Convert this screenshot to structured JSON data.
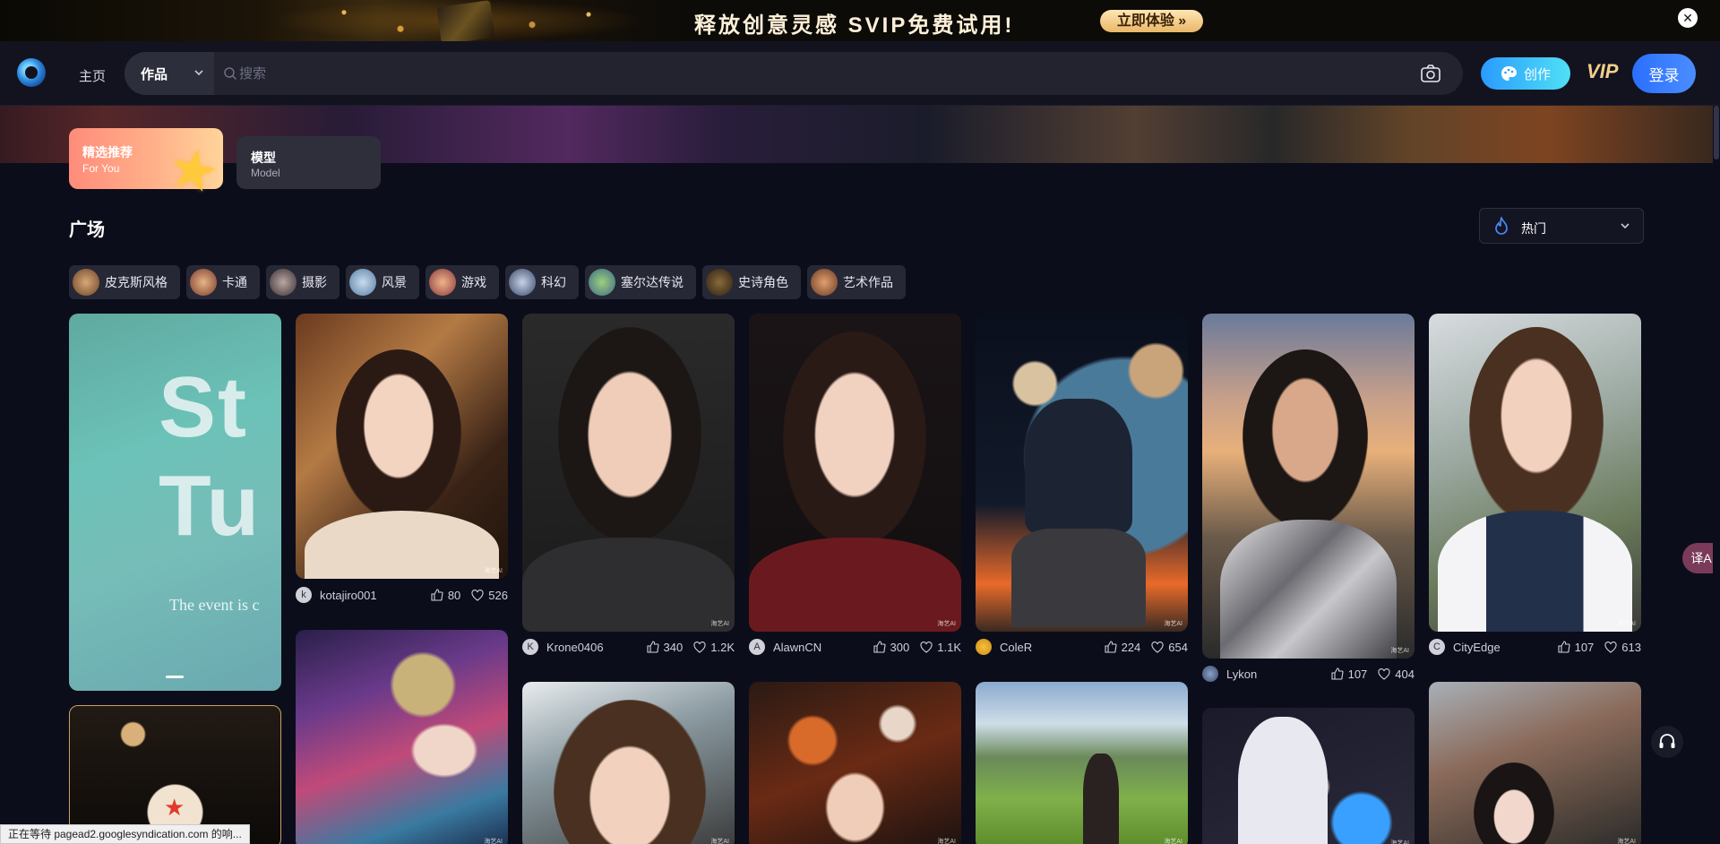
{
  "promo": {
    "text": "释放创意灵感   SVIP免费试用!",
    "button": "立即体验 »",
    "close": "✕"
  },
  "header": {
    "home": "主页",
    "search_type": "作品",
    "search_placeholder": "搜索",
    "create": "创作",
    "vip": "VIP",
    "login": "登录"
  },
  "tabs": [
    {
      "title": "精选推荐",
      "subtitle": "For You"
    },
    {
      "title": "模型",
      "subtitle": "Model"
    }
  ],
  "section": {
    "title": "广场",
    "sort": "热门"
  },
  "chips": [
    "皮克斯风格",
    "卡通",
    "摄影",
    "风景",
    "游戏",
    "科幻",
    "塞尔达传说",
    "史诗角色",
    "艺术作品"
  ],
  "banner": {
    "big_line1": "St",
    "big_line2": "Tu",
    "subtitle": "The event is c"
  },
  "cards": [
    {
      "user": "kotajiro001",
      "initial": "k",
      "likes": "80",
      "favs": "526"
    },
    {
      "user": "Krone0406",
      "initial": "K",
      "likes": "340",
      "favs": "1.2K"
    },
    {
      "user": "AlawnCN",
      "initial": "A",
      "likes": "300",
      "favs": "1.1K"
    },
    {
      "user": "ColeR",
      "initial": "",
      "likes": "224",
      "favs": "654"
    },
    {
      "user": "Lykon",
      "initial": "",
      "likes": "107",
      "favs": "404"
    },
    {
      "user": "CityEdge",
      "initial": "C",
      "likes": "107",
      "favs": "613"
    }
  ],
  "watermark": "海艺AI",
  "translate": "译A",
  "status": "正在等待 pagead2.googlesyndication.com 的响..."
}
